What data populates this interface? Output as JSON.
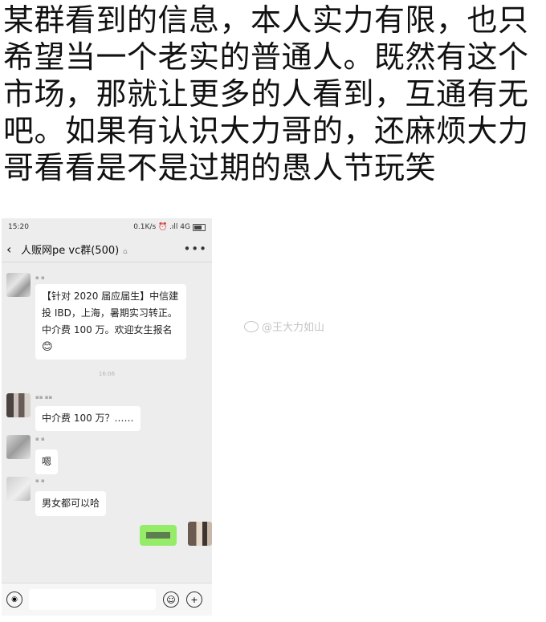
{
  "post": {
    "text": "某群看到的信息，本人实力有限，也只希望当一个老实的普通人。既然有这个市场，那就让更多的人看到，互通有无吧。如果有认识大力哥的，还麻烦大力哥看看是不是过期的愚人节玩笑"
  },
  "phone": {
    "status": {
      "time": "15:20",
      "right": "0.1K/s ⏰ .ıll 4G"
    },
    "chat_title": "人贩网pe vc群(500)",
    "icons": {
      "back": "chevron-left-icon",
      "mute": "mute-icon",
      "more": "more-icon"
    },
    "messages": [
      {
        "text": "【针对 2020 届应届生】中信建投 IBD，上海，暑期实习转正。中介费 100 万。欢迎女生报名",
        "emoji": "😊"
      },
      {
        "text": "中介费 100 万？……"
      },
      {
        "text": "嗯"
      },
      {
        "text": "男女都可以哈"
      }
    ],
    "time_divider": "16:06",
    "colors": {
      "self_bubble": "#95ec69",
      "background": "#ededed"
    }
  },
  "watermark": {
    "text": "@王大力如山"
  }
}
